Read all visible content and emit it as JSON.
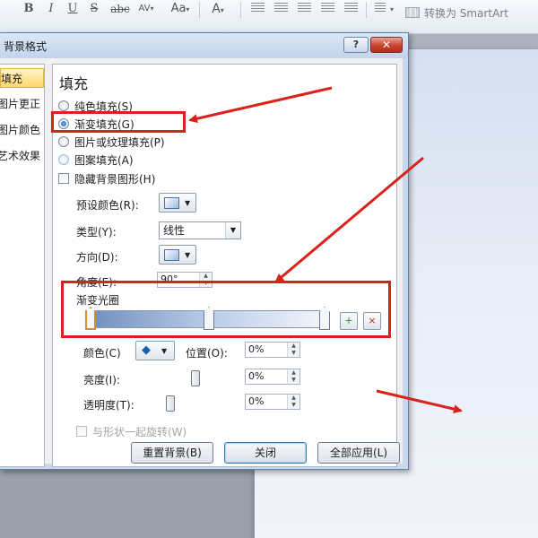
{
  "ribbon": {
    "font_buttons": [
      "B",
      "I",
      "U",
      "S",
      "abc",
      "AV",
      "Aa",
      "A"
    ],
    "smartart_label": "转换为 SmartArt"
  },
  "dialog": {
    "title": "背景格式",
    "help_label": "?",
    "close_label": "✕",
    "nav_items": [
      "填充",
      "图片更正",
      "图片颜色",
      "艺术效果"
    ],
    "section_title": "填充",
    "fill_options": [
      {
        "label": "纯色填充(S)",
        "selected": false
      },
      {
        "label": "渐变填充(G)",
        "selected": true
      },
      {
        "label": "图片或纹理填充(P)",
        "selected": false
      },
      {
        "label": "图案填充(A)",
        "selected": false
      }
    ],
    "hide_bg_label": "隐藏背景图形(H)",
    "preset_label": "预设颜色(R):",
    "type_label": "类型(Y):",
    "type_value": "线性",
    "direction_label": "方向(D):",
    "angle_label": "角度(E):",
    "angle_value": "90°",
    "stops_label": "渐变光圈",
    "color_label": "颜色(C)",
    "position_label": "位置(O):",
    "position_value": "0%",
    "brightness_label": "亮度(I):",
    "brightness_value": "0%",
    "transparency_label": "透明度(T):",
    "transparency_value": "0%",
    "rotate_label": "与形状一起旋转(W)",
    "buttons": {
      "reset": "重置背景(B)",
      "close": "关闭",
      "apply_all": "全部应用(L)"
    }
  },
  "colors": {
    "annotation_red": "#d9221b",
    "selection_yellow": "#ffd970",
    "title_blue": "#c2d4ec"
  }
}
